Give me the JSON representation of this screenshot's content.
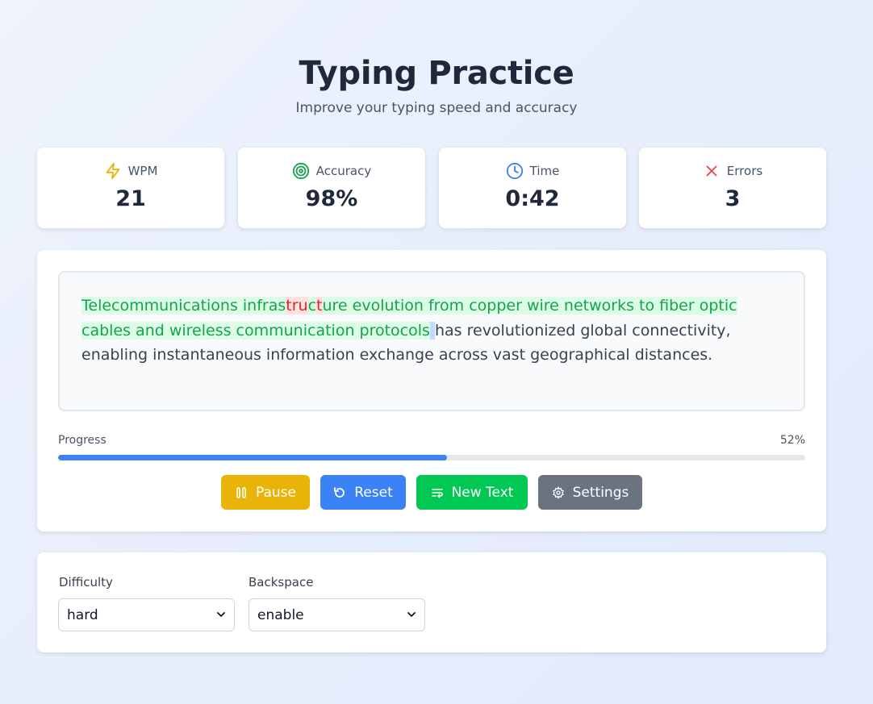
{
  "header": {
    "title": "Typing Practice",
    "subtitle": "Improve your typing speed and accuracy"
  },
  "stats": {
    "wpm": {
      "label": "WPM",
      "value": "21",
      "icon": "lightning-icon",
      "color": "#eab308"
    },
    "accuracy": {
      "label": "Accuracy",
      "value": "98%",
      "icon": "target-icon",
      "color": "#16a34a"
    },
    "time": {
      "label": "Time",
      "value": "0:42",
      "icon": "clock-icon",
      "color": "#3b82f6"
    },
    "errors": {
      "label": "Errors",
      "value": "3",
      "icon": "x-icon",
      "color": "#ef4444"
    }
  },
  "passage": {
    "typed_1": "Telecommunications infras",
    "error_1": "t",
    "error_2": "r",
    "error_3": "u",
    "typed_2": "c",
    "error_4": "t",
    "typed_3": "ure evolution from copper wire networks to fiber optic cables and wireless communication protocols",
    "caret": " ",
    "remaining": "has revolutionized global connectivity, enabling instantaneous information exchange across vast geographical distances."
  },
  "progress": {
    "label": "Progress",
    "percent_text": "52%",
    "percent": 52
  },
  "buttons": {
    "pause": "Pause",
    "reset": "Reset",
    "new_text": "New Text",
    "settings": "Settings"
  },
  "options": {
    "difficulty": {
      "label": "Difficulty",
      "value": "hard"
    },
    "backspace": {
      "label": "Backspace",
      "value": "enable"
    }
  },
  "colors": {
    "pause": "#eab308",
    "reset": "#3b82f6",
    "new_text": "#00c853",
    "settings": "#6b7280",
    "correct": "#16a34a",
    "error": "#dc2626"
  }
}
